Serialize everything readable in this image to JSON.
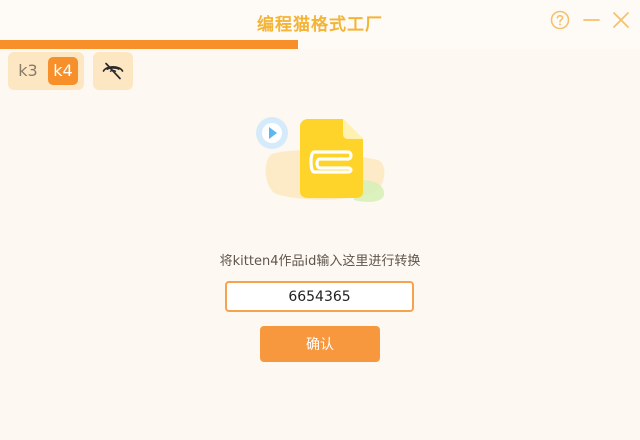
{
  "window": {
    "title": "编程猫格式工厂"
  },
  "progress": {
    "fraction": 0.465,
    "color": "#f7902b"
  },
  "toolbar": {
    "versions": [
      "k3",
      "k4"
    ],
    "selected_version": "k4",
    "visibility_icon": "eye-off-icon"
  },
  "form": {
    "instruction": "将kitten4作品id输入这里进行转换",
    "input_value": "6654365",
    "confirm_label": "确认"
  },
  "colors": {
    "accent": "#f7902b",
    "title": "#f4b436",
    "background": "#fdf8f2"
  }
}
